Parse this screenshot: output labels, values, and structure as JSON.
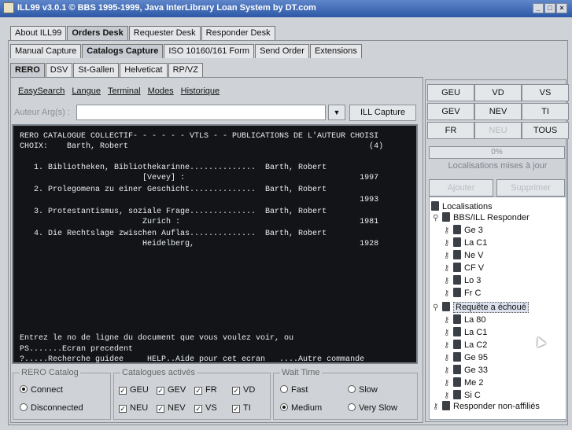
{
  "window": {
    "title": "ILL99 v3.0.1 © BBS 1995-1999, Java InterLibrary Loan System by DT.com",
    "controls": [
      "_",
      "□",
      "×"
    ]
  },
  "tabs_top": [
    {
      "label": "About ILL99",
      "selected": false
    },
    {
      "label": "Orders Desk",
      "selected": true
    },
    {
      "label": "Requester Desk",
      "selected": false
    },
    {
      "label": "Responder Desk",
      "selected": false
    }
  ],
  "tabs_sub": [
    {
      "label": "Manual Capture",
      "selected": false
    },
    {
      "label": "Catalogs Capture",
      "selected": true
    },
    {
      "label": "ISO 10160/161 Form",
      "selected": false
    },
    {
      "label": "Send Order",
      "selected": false
    },
    {
      "label": "Extensions",
      "selected": false
    }
  ],
  "tabs_cat": [
    {
      "label": "RERO",
      "selected": true
    },
    {
      "label": "DSV",
      "selected": false
    },
    {
      "label": "St-Gallen",
      "selected": false
    },
    {
      "label": "Helveticat",
      "selected": false
    },
    {
      "label": "RP/VZ",
      "selected": false
    }
  ],
  "menu": [
    "EasySearch",
    "Langue",
    "Terminal",
    "Modes",
    "Historique"
  ],
  "search": {
    "label": "Auteur Arg(s) :",
    "value": "",
    "capture_button": "ILL Capture"
  },
  "terminal": {
    "lines": [
      "RERO CATALOGUE COLLECTIF- - - - - - VTLS - - PUBLICATIONS DE L'AUTEUR CHOISI",
      "CHOIX:    Barth, Robert                                                   (4)",
      "",
      "   1. Bibliotheken, Bibliothekarinne..............  Barth, Robert",
      "                          [Vevey] :                                     1997",
      "   2. Prolegomena zu einer Geschicht..............  Barth, Robert",
      "                                                                        1993",
      "   3. Protestantismus, soziale Frage..............  Barth, Robert",
      "                          Zurich :                                      1981",
      "   4. Die Rechtslage zwischen Auflas..............  Barth, Robert",
      "                          Heidelberg,                                   1928",
      "",
      "",
      "",
      "",
      "",
      "",
      "",
      "",
      "Entrez le no de ligne du document que vous voulez voir, ou",
      "PS.......Ecran precedent",
      "?.....Recherche guidee     HELP..Aide pour cet ecran   ....Autre commande"
    ]
  },
  "rero_catalog": {
    "title": "RERO Catalog",
    "options": [
      {
        "label": "Connect",
        "selected": true
      },
      {
        "label": "Disconnected",
        "selected": false
      }
    ]
  },
  "catalogues": {
    "title": "Catalogues activés",
    "items": [
      {
        "label": "GEU",
        "checked": true
      },
      {
        "label": "GEV",
        "checked": true
      },
      {
        "label": "FR",
        "checked": true
      },
      {
        "label": "VD",
        "checked": true
      },
      {
        "label": "NEU",
        "checked": true
      },
      {
        "label": "NEV",
        "checked": true
      },
      {
        "label": "VS",
        "checked": true
      },
      {
        "label": "TI",
        "checked": true
      }
    ]
  },
  "wait_time": {
    "title": "Wait Time",
    "options": [
      {
        "label": "Fast",
        "selected": false
      },
      {
        "label": "Slow",
        "selected": false
      },
      {
        "label": "Medium",
        "selected": true
      },
      {
        "label": "Very Slow",
        "selected": false
      }
    ]
  },
  "grid_buttons": [
    {
      "label": "GEU",
      "enabled": true
    },
    {
      "label": "VD",
      "enabled": true
    },
    {
      "label": "VS",
      "enabled": true
    },
    {
      "label": "GEV",
      "enabled": true
    },
    {
      "label": "NEV",
      "enabled": true
    },
    {
      "label": "TI",
      "enabled": true
    },
    {
      "label": "FR",
      "enabled": true
    },
    {
      "label": "NEU",
      "enabled": false
    },
    {
      "label": "TOUS",
      "enabled": true
    }
  ],
  "progress": {
    "value": 0,
    "text": "0%",
    "status": "Localisations mises à jour"
  },
  "actions": {
    "add": "Ajouter",
    "remove": "Supprimer"
  },
  "tree": {
    "root": "Localisations",
    "nodes": [
      {
        "label": "BBS/ILL Responder",
        "level": 1,
        "expanded": true,
        "highlight": false
      },
      {
        "label": "Ge 3",
        "level": 2
      },
      {
        "label": "La C1",
        "level": 2
      },
      {
        "label": "Ne V",
        "level": 2
      },
      {
        "label": "CF V",
        "level": 2
      },
      {
        "label": "Lo 3",
        "level": 2
      },
      {
        "label": "Fr C",
        "level": 2
      },
      {
        "label": "Requête a échoué",
        "level": 1,
        "expanded": true,
        "highlight": true
      },
      {
        "label": "La 80",
        "level": 2
      },
      {
        "label": "La C1",
        "level": 2
      },
      {
        "label": "La C2",
        "level": 2
      },
      {
        "label": "Ge 95",
        "level": 2
      },
      {
        "label": "Ge 33",
        "level": 2
      },
      {
        "label": "Me 2",
        "level": 2
      },
      {
        "label": "Si C",
        "level": 2
      },
      {
        "label": "Responder non-affiliés",
        "level": 1,
        "expanded": false,
        "highlight": false
      }
    ]
  }
}
